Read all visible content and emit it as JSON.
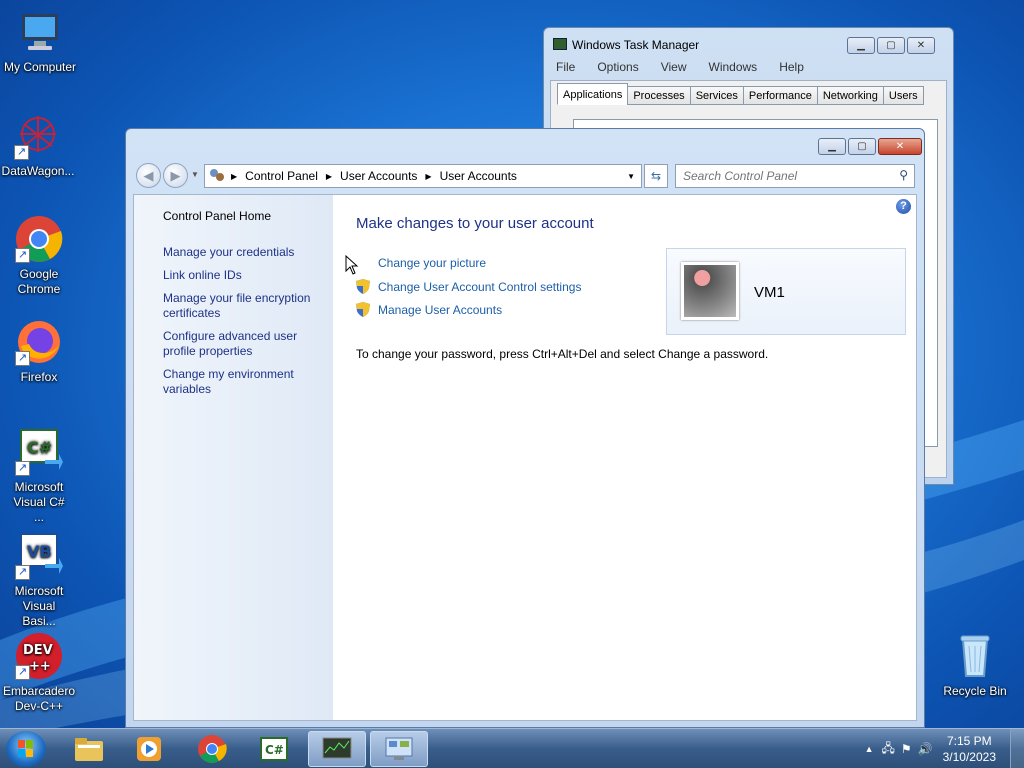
{
  "desktop": {
    "icons": [
      {
        "label": "My Computer"
      },
      {
        "label": "DataWagon..."
      },
      {
        "label": "Google Chrome"
      },
      {
        "label": "Firefox"
      },
      {
        "label": "Microsoft Visual C# ..."
      },
      {
        "label": "Microsoft Visual Basi..."
      },
      {
        "label": "Embarcadero Dev-C++"
      },
      {
        "label": "Recycle Bin"
      }
    ]
  },
  "task_manager": {
    "title": "Windows Task Manager",
    "menu": [
      "File",
      "Options",
      "View",
      "Windows",
      "Help"
    ],
    "tabs": [
      "Applications",
      "Processes",
      "Services",
      "Performance",
      "Networking",
      "Users"
    ],
    "active_tab": "Applications"
  },
  "control_panel": {
    "breadcrumb": [
      "Control Panel",
      "User Accounts",
      "User Accounts"
    ],
    "search_placeholder": "Search Control Panel",
    "sidebar": {
      "home": "Control Panel Home",
      "links": [
        "Manage your credentials",
        "Link online IDs",
        "Manage your file encryption certificates",
        "Configure advanced user profile properties",
        "Change my environment variables"
      ]
    },
    "heading": "Make changes to your user account",
    "tasks": [
      "Change your picture",
      "Change User Account Control settings",
      "Manage User Accounts"
    ],
    "password_note": "To change your password, press Ctrl+Alt+Del and select Change a password.",
    "account_name": "VM1",
    "help_label": "?"
  },
  "taskbar": {
    "time": "7:15 PM",
    "date": "3/10/2023"
  },
  "colors": {
    "link": "#1e3287",
    "task_link": "#1d5fa8",
    "desktop_bg": "#1d78d8"
  }
}
